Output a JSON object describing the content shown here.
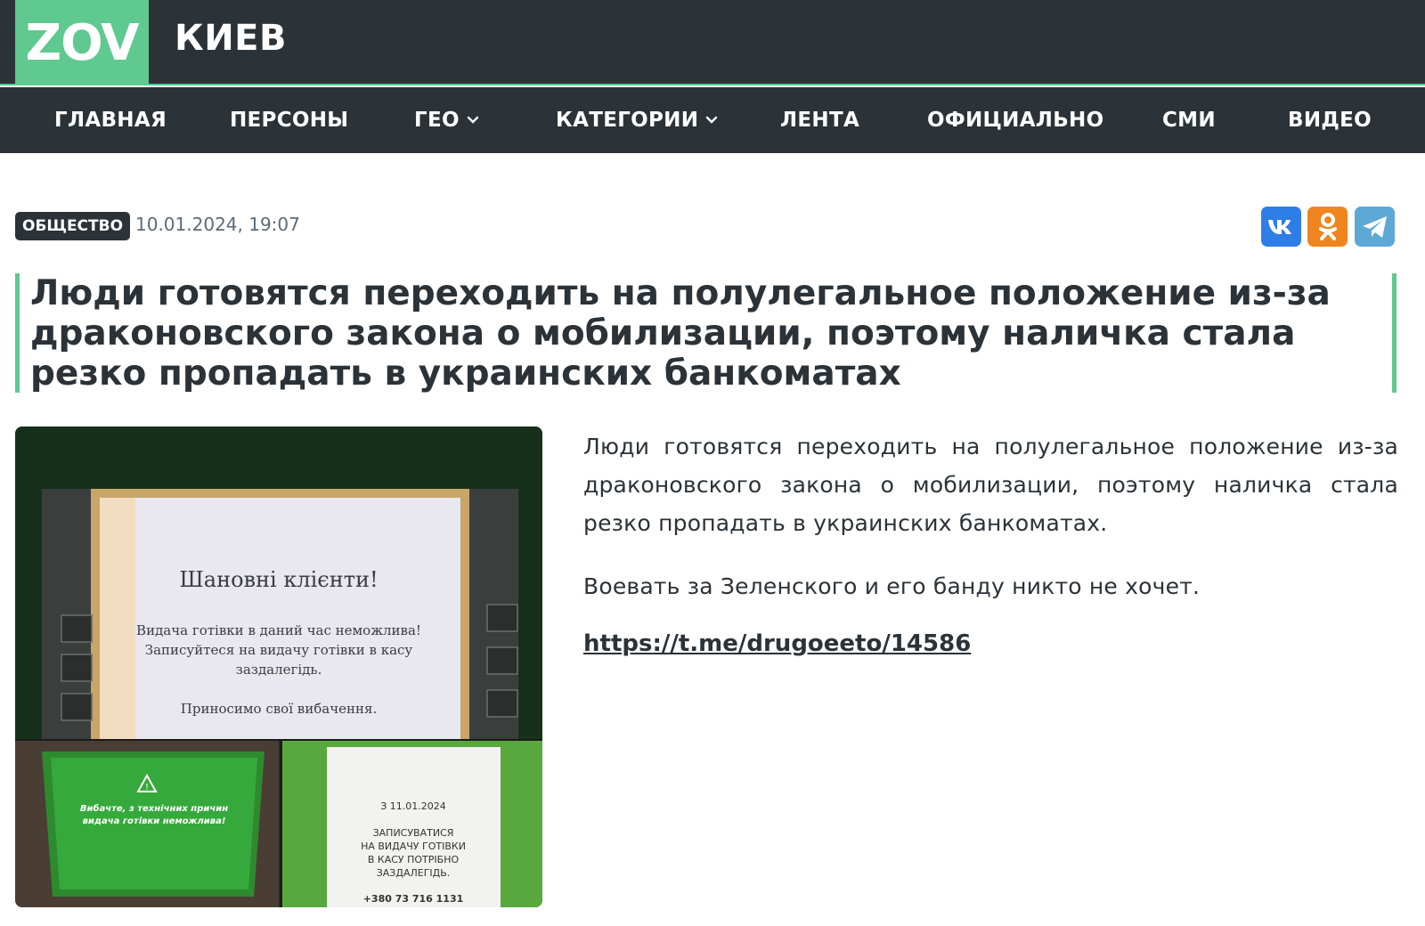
{
  "header": {
    "logo": "ZOV",
    "city": "КИЕВ"
  },
  "nav": {
    "items": [
      {
        "label": "ГЛАВНАЯ"
      },
      {
        "label": "ПЕРСОНЫ"
      },
      {
        "label": "ГЕО"
      },
      {
        "label": "КАТЕГОРИИ"
      },
      {
        "label": "ЛЕНТА"
      },
      {
        "label": "ОФИЦИАЛЬНО"
      },
      {
        "label": "СМИ"
      },
      {
        "label": "ВИДЕО"
      }
    ]
  },
  "article": {
    "category": "ОБЩЕСТВО",
    "date": "10.01.2024, 19:07",
    "title": "Люди готовятся переходить на полулегальное положение из-за драконовского закона о мобилизации, поэтому наличка стала резко пропадать в украинских банкоматах",
    "paragraphs": [
      "Люди готовятся переходить на полулегальное положение из-за драконовского закона о мобилизации, поэтому наличка стала резко пропадать в украинских банкоматах.",
      "Воевать за Зеленского и его банду никто не хочет."
    ],
    "link": "https://t.me/drugoeeto/14586"
  },
  "share": {
    "vk_label": "VK",
    "icons": [
      "vk-icon",
      "odnoklassniki-icon",
      "telegram-icon"
    ]
  },
  "photo": {
    "atm_heading": "Шановні клієнти!",
    "atm_line1": "Видача готівки в даний час неможлива!",
    "atm_line2": "Записуйтеся на видачу готівки в касу",
    "atm_line3": "заздалегідь.",
    "atm_apology": "Приносимо свої вибачення.",
    "screen_line1": "Вибачте, з технічних причин",
    "screen_line2": "видача готівки неможлива!",
    "notice_date": "З 11.01.2024",
    "notice_line1": "ЗАПИСУВАТИСЯ",
    "notice_line2": "НА ВИДАЧУ ГОТІВКИ",
    "notice_line3": "В КАСУ ПОТРІБНО",
    "notice_line4": "ЗАЗДАЛЕГІДЬ.",
    "notice_phone": "+380 73 716 1131"
  },
  "colors": {
    "header_bg": "#2b3238",
    "accent": "#5fc98f",
    "vk": "#2f7de6",
    "ok": "#f0851f",
    "telegram": "#5ea8d6"
  }
}
